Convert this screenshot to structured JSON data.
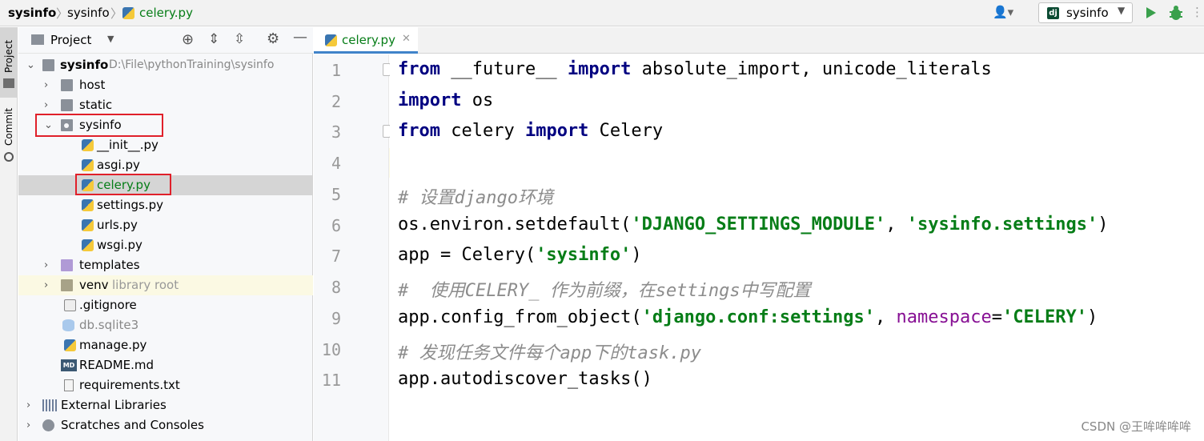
{
  "navbar": {
    "crumb1": "sysinfo",
    "crumb2": "sysinfo",
    "crumb3": "celery.py",
    "run_config": "sysinfo"
  },
  "toolstrip": {
    "project_tab": "Project",
    "commit_tab": "Commit"
  },
  "project_panel": {
    "title": "Project",
    "tree": [
      {
        "label": "sysinfo",
        "hint": "D:\\File\\pythonTraining\\sysinfo"
      },
      {
        "label": "host"
      },
      {
        "label": "static"
      },
      {
        "label": "sysinfo"
      },
      {
        "label": "__init__.py"
      },
      {
        "label": "asgi.py"
      },
      {
        "label": "celery.py"
      },
      {
        "label": "settings.py"
      },
      {
        "label": "urls.py"
      },
      {
        "label": "wsgi.py"
      },
      {
        "label": "templates"
      },
      {
        "label": "venv",
        "hint": "library root"
      },
      {
        "label": ".gitignore"
      },
      {
        "label": "db.sqlite3"
      },
      {
        "label": "manage.py"
      },
      {
        "label": "README.md"
      },
      {
        "label": "requirements.txt"
      },
      {
        "label": "External Libraries"
      },
      {
        "label": "Scratches and Consoles"
      }
    ]
  },
  "editor": {
    "tab_label": "celery.py",
    "line_numbers": [
      "1",
      "2",
      "3",
      "4",
      "5",
      "6",
      "7",
      "8",
      "9",
      "10",
      "11"
    ],
    "lines": {
      "l1_kw1": "from",
      "l1_a": " __future__ ",
      "l1_kw2": "import",
      "l1_b": " absolute_import, unicode_literals",
      "l2_kw": "import",
      "l2_a": " os",
      "l3_kw1": "from",
      "l3_a": " celery ",
      "l3_kw2": "import",
      "l3_b": " Celery",
      "l5_cmt": "# 设置django环境",
      "l6_a": "os.environ.setdefault(",
      "l6_s1": "'DJANGO_SETTINGS_MODULE'",
      "l6_b": ", ",
      "l6_s2": "'sysinfo.settings'",
      "l6_c": ")",
      "l7_a": "app = Celery(",
      "l7_s": "'sysinfo'",
      "l7_b": ")",
      "l8_cmt": "#  使用CELERY_ 作为前缀，在settings中写配置",
      "l9_a": "app.config_from_object(",
      "l9_s1": "'django.conf:settings'",
      "l9_b": ", ",
      "l9_p": "namespace",
      "l9_c": "=",
      "l9_s2": "'CELERY'",
      "l9_d": ")",
      "l10_cmt": "# 发现任务文件每个app下的task.py",
      "l11_a": "app.autodiscover_tasks()"
    }
  },
  "watermark": "CSDN @王哞哞哞哞"
}
